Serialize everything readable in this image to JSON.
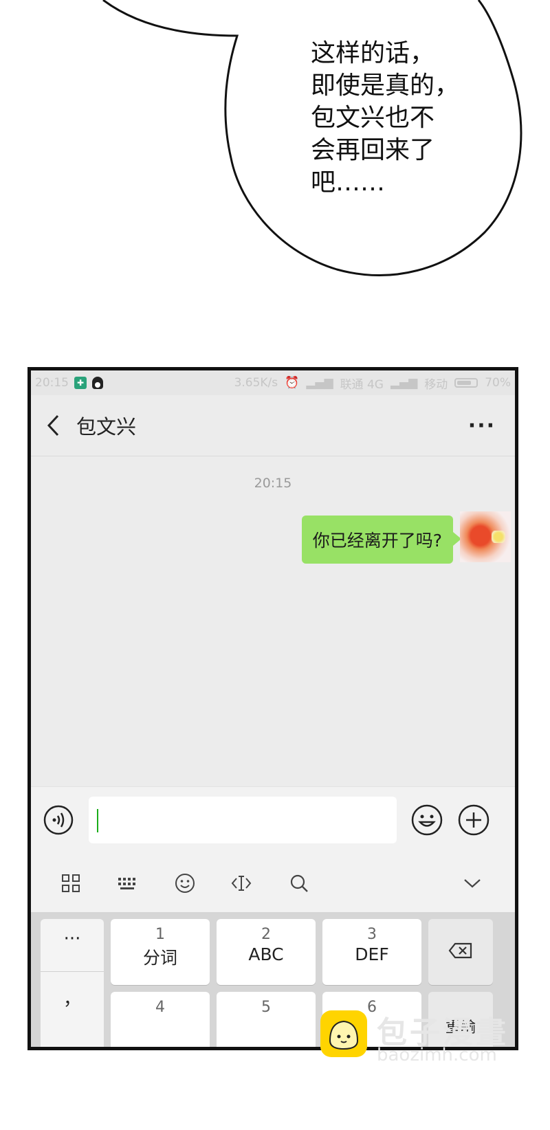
{
  "speech_bubble": {
    "lines": [
      "这样的话，",
      "即使是真的，",
      "包文兴也不",
      "会再回来了",
      "吧……"
    ]
  },
  "status_bar": {
    "time": "20:15",
    "net_speed": "3.65K/s",
    "carrier1": "联通 4G",
    "carrier2": "移动",
    "battery": "70%"
  },
  "nav": {
    "contact_name": "包文兴",
    "more": "···"
  },
  "chat": {
    "timestamp": "20:15",
    "message": "你已经离开了吗?"
  },
  "keyboard": {
    "side_keys": [
      "···",
      "，"
    ],
    "keys": [
      {
        "num": "1",
        "label": "分词"
      },
      {
        "num": "2",
        "label": "ABC"
      },
      {
        "num": "3",
        "label": "DEF"
      },
      {
        "num": "4",
        "label": ""
      },
      {
        "num": "5",
        "label": ""
      },
      {
        "num": "6",
        "label": ""
      }
    ],
    "partial_key": "重输"
  },
  "watermark": {
    "title": "包子漫畫",
    "url": "baozimh.com",
    "accent": "#ffd400"
  },
  "colors": {
    "message_bubble": "#98e165",
    "caret": "#1aad19"
  }
}
